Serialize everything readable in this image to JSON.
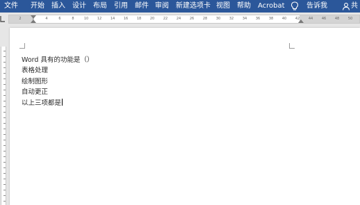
{
  "ribbon": {
    "tabs": [
      "文件",
      "开始",
      "插入",
      "设计",
      "布局",
      "引用",
      "邮件",
      "审阅",
      "新建选项卡",
      "视图",
      "帮助",
      "Acrobat"
    ],
    "tell_me": "告诉我",
    "share": "共"
  },
  "ruler": {
    "ticks": [
      "2",
      "2",
      "4",
      "6",
      "8",
      "10",
      "12",
      "14",
      "16",
      "18",
      "20",
      "22",
      "24",
      "26",
      "28",
      "30",
      "32",
      "34",
      "36",
      "38",
      "40",
      "42",
      "44",
      "46",
      "48",
      "50"
    ]
  },
  "document": {
    "lines": [
      "Word 具有的功能是（）",
      "表格处理",
      "绘制图形",
      "自动更正",
      "以上三项都是"
    ]
  },
  "icons": {
    "bulb": "lightbulb-icon",
    "share": "share-person-icon"
  },
  "colors": {
    "ribbon": "#2b579a",
    "canvas": "#e6e6e6",
    "page": "#ffffff"
  }
}
